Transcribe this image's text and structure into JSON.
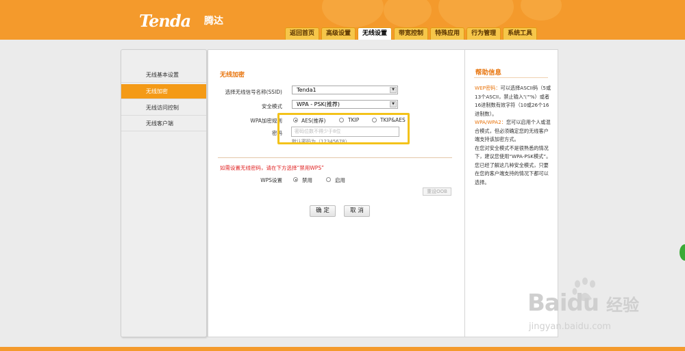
{
  "brand": {
    "logo": "Tenda",
    "logo_cn": "腾达"
  },
  "nav": {
    "tabs": [
      {
        "label": "返回首页",
        "active": false
      },
      {
        "label": "高级设置",
        "active": false
      },
      {
        "label": "无线设置",
        "active": true
      },
      {
        "label": "带宽控制",
        "active": false
      },
      {
        "label": "特殊应用",
        "active": false
      },
      {
        "label": "行为管理",
        "active": false
      },
      {
        "label": "系统工具",
        "active": false
      }
    ]
  },
  "sidebar": {
    "items": [
      {
        "label": "无线基本设置",
        "active": false
      },
      {
        "label": "无线加密",
        "active": true
      },
      {
        "label": "无线访问控制",
        "active": false
      },
      {
        "label": "无线客户端",
        "active": false
      }
    ]
  },
  "main": {
    "section_title": "无线加密",
    "ssid": {
      "label": "选择无线信号名称(SSID)",
      "value": "Tenda1"
    },
    "security_mode": {
      "label": "安全模式",
      "value": "WPA - PSK(推荐)"
    },
    "wpa_algo": {
      "label": "WPA加密规则",
      "options": [
        {
          "label": "AES(推荐)",
          "checked": true
        },
        {
          "label": "TKIP",
          "checked": false
        },
        {
          "label": "TKIP&AES",
          "checked": false
        }
      ]
    },
    "password": {
      "label": "密码",
      "placeholder": "密码位数不得少于8位",
      "hint": "默认密码为（12345678）"
    },
    "warning": "如需设置无线密码，请在下方选择“禁用WPS”",
    "wps": {
      "label": "WPS设置",
      "options": [
        {
          "label": "禁用",
          "checked": true
        },
        {
          "label": "启用",
          "checked": false
        }
      ],
      "reset_label": "重设OOB"
    },
    "confirm_label": "确 定",
    "cancel_label": "取 消"
  },
  "help": {
    "title": "帮助信息",
    "wep_key": "WEP密码：",
    "wep_text": "可以选择ASCII码（5或13个ASCII，禁止输入'\\'\"%）或者16进制数有效字符（10或26个16进制数）。",
    "wpa_key": "WPA/WPA2：",
    "wpa_text": "您可以启用个人或混合模式，但必须确定您的无线客户端支持该加密方式。",
    "extra_text": "在您对安全模式不是很熟悉的情况下，建议您使用“WPA-PSK模式”。您已经了解这几种安全模式，只要在您的客户端支持的情况下都可以选择。"
  },
  "watermark": {
    "brand": "Bai",
    "brand2": "du",
    "cn": "经验",
    "url": "jingyan.baidu.com"
  },
  "colors": {
    "accent": "#f49a2c",
    "highlight_box": "#f3c21a",
    "warning": "#e02020"
  }
}
